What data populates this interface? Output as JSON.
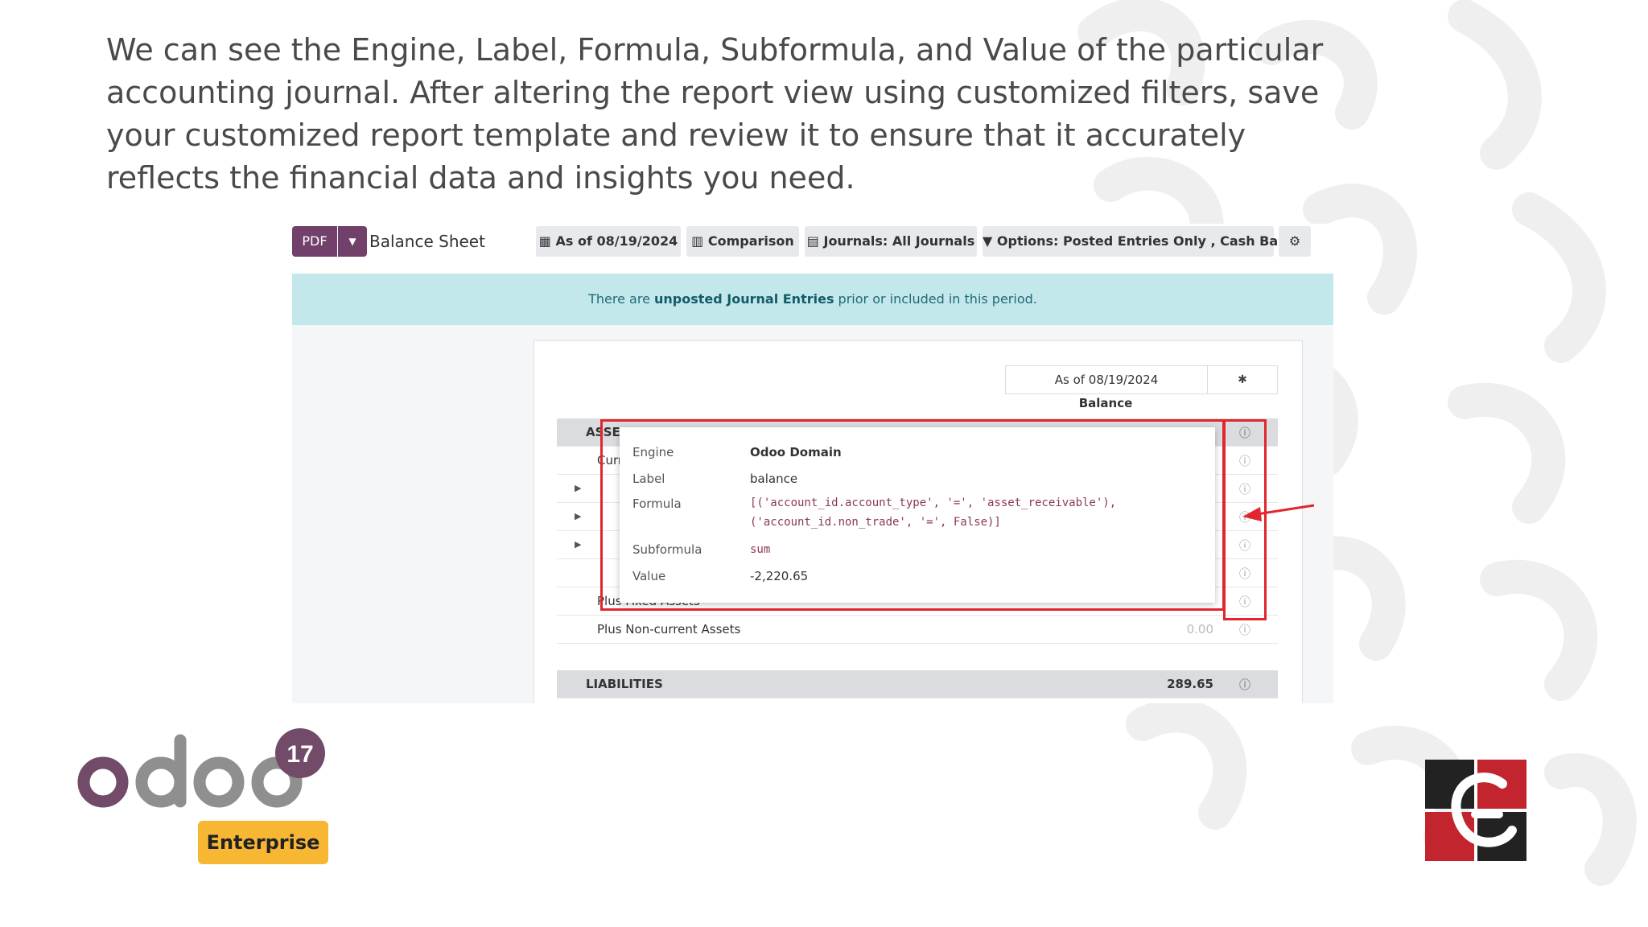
{
  "intro": {
    "text": "We can see the Engine, Label, Formula, Subformula, and Value of the particular accounting journal. After altering the report view using customized filters, save your customized report template and review it to ensure that it accurately reflects the financial data and insights you need."
  },
  "screenshot": {
    "pdf_label": "PDF",
    "page_title": "Balance Sheet",
    "toolbar": {
      "date": "As of 08/19/2024",
      "comparison": "Comparison",
      "journals": "Journals: All Journals",
      "options": "Options: Posted Entries Only , Cash Basis"
    },
    "banner": {
      "prefix": "There are ",
      "link": "unposted Journal Entries",
      "suffix": " prior or included in this period."
    },
    "report": {
      "date_header": "As of 08/19/2024",
      "column_header": "Balance",
      "rows": [
        {
          "label": "ASSETS",
          "value": "",
          "style": "grey"
        },
        {
          "label": "Current Assets",
          "value": ""
        },
        {
          "label": "",
          "value": ""
        },
        {
          "label": "",
          "value": ""
        },
        {
          "label": "",
          "value": ""
        },
        {
          "label": "",
          "value": ""
        },
        {
          "label": "Plus Fixed Assets",
          "value": ""
        },
        {
          "label": "Plus Non-current Assets",
          "value": "0.00"
        },
        {
          "label": "LIABILITIES",
          "value": "289.65",
          "style": "grey"
        }
      ]
    },
    "popup": {
      "engine_label": "Engine",
      "engine_value": "Odoo Domain",
      "label_label": "Label",
      "label_value": "balance",
      "formula_label": "Formula",
      "formula_line1": "[('account_id.account_type', '=', 'asset_receivable'),",
      "formula_line2": "('account_id.non_trade', '=', False)]",
      "subformula_label": "Subformula",
      "subformula_value": "sum",
      "value_label": "Value",
      "value_value": "-2,220.65"
    }
  },
  "branding": {
    "odoo_text": "odoo",
    "version_badge": "17",
    "edition_badge": "Enterprise",
    "colors": {
      "odoo_purple": "#714b67",
      "odoo_grey": "#8f8f8f",
      "enterprise_yellow": "#f7b733",
      "accent_red": "#e1262d"
    }
  }
}
